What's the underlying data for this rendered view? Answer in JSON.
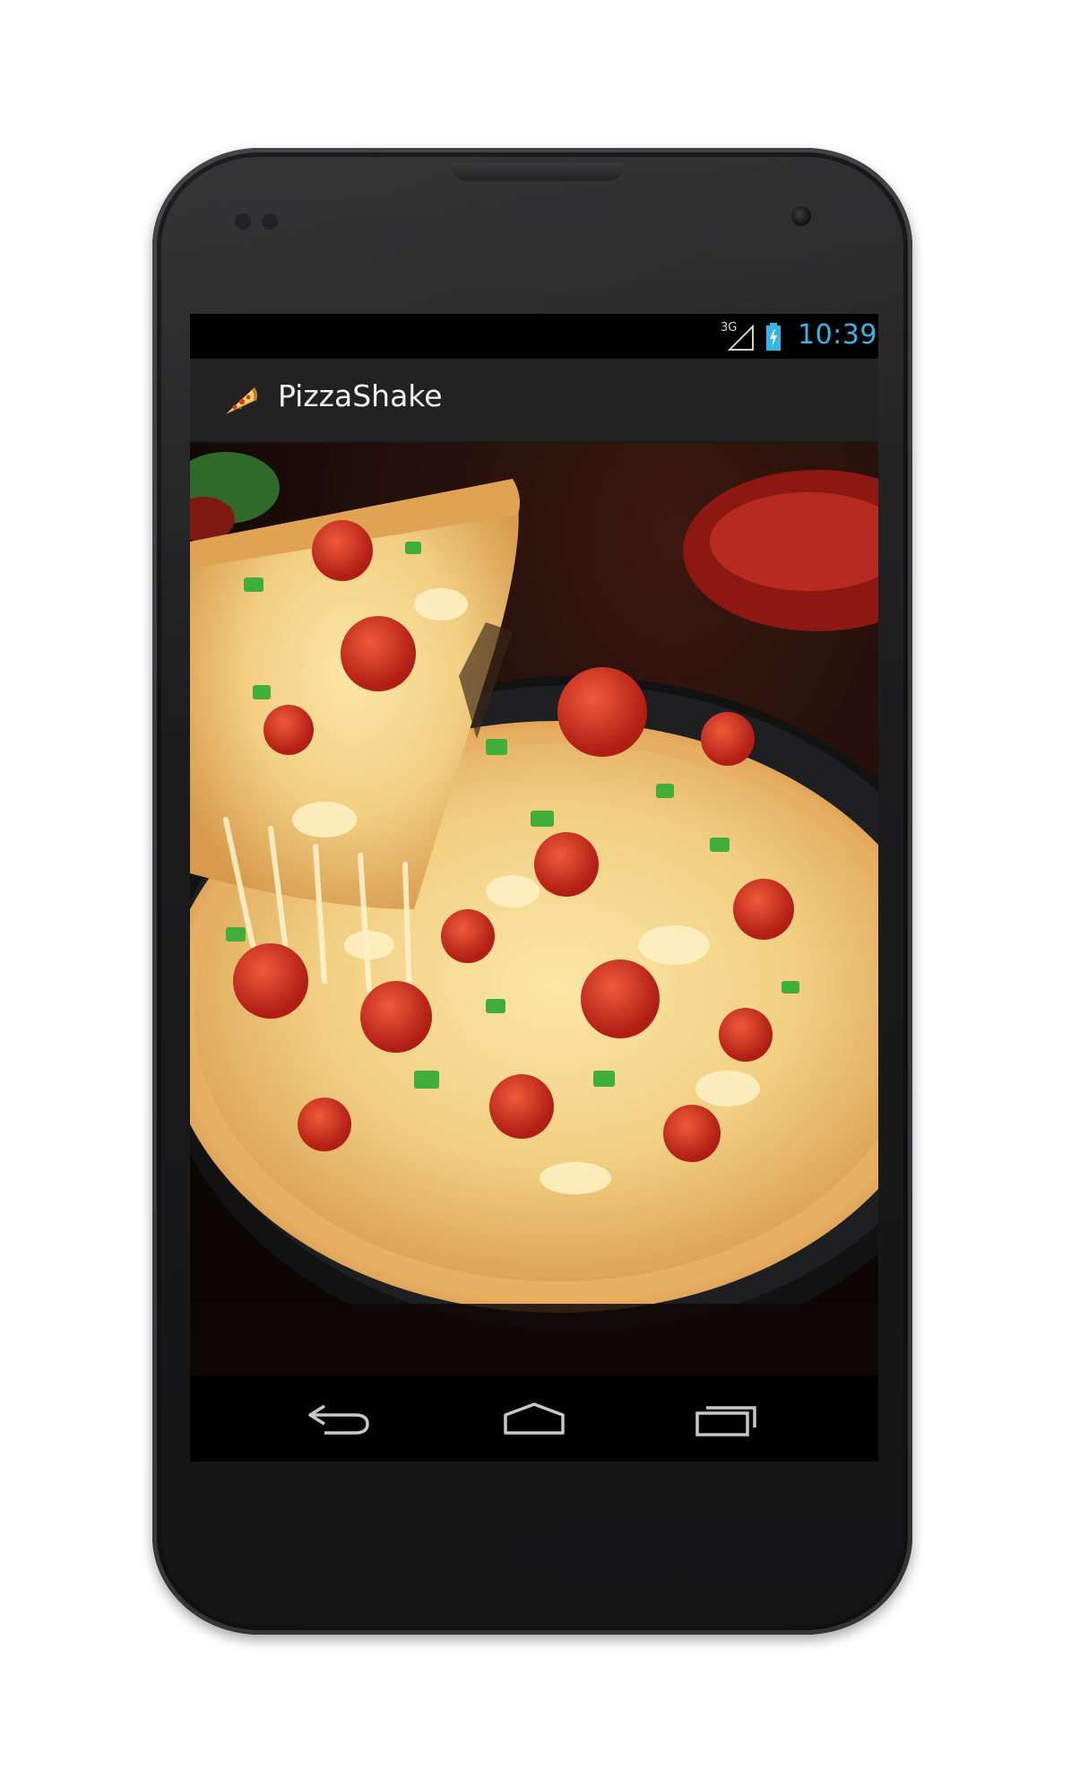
{
  "status_bar": {
    "network": "3G",
    "time": "10:39",
    "time_color": "#33b5e5"
  },
  "action_bar": {
    "app_icon": "pizza-slice-icon",
    "title": "PizzaShake"
  },
  "content": {
    "image": "pizza-photo"
  },
  "nav_bar": {
    "buttons": [
      "back-icon",
      "home-icon",
      "recent-apps-icon"
    ]
  }
}
